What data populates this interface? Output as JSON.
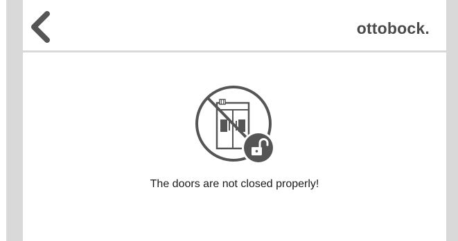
{
  "header": {
    "brand": "ottobock.",
    "back_icon": "chevron-left-icon"
  },
  "status": {
    "icon": "doors-open-unlocked-icon",
    "message": "The doors are not closed properly!"
  },
  "colors": {
    "icon_gray": "#555555",
    "side_bar": "#d9d9d9",
    "divider": "#d9d9d9",
    "text": "#1a1a1a"
  }
}
